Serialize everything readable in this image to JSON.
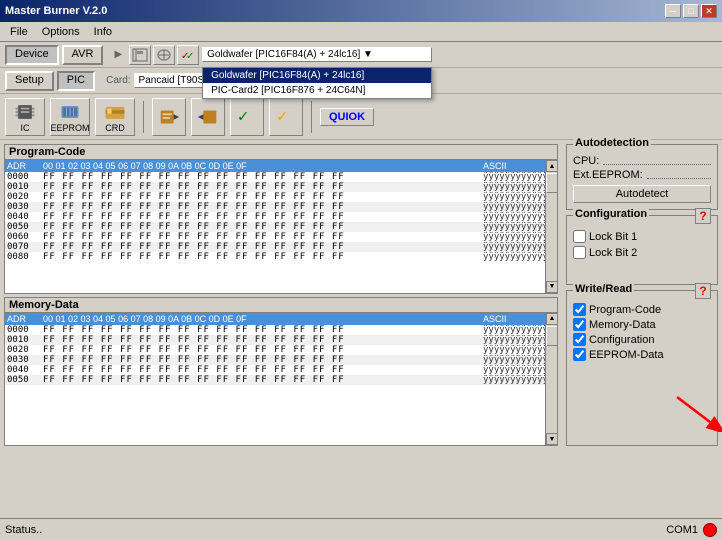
{
  "window": {
    "title": "Master Burner V.2.0",
    "min_btn": "─",
    "max_btn": "□",
    "close_btn": "✕"
  },
  "menu": {
    "items": [
      "File",
      "Options",
      "Info"
    ]
  },
  "toolbar": {
    "device_label": "Device",
    "avr_label": "AVR",
    "setup_label": "Setup",
    "pic_label": "PIC"
  },
  "dropdown_popup": {
    "items": [
      "Goldwafer [PIC16F84(A) + 24lc16]",
      "PIC-Card2 [PIC16F876 + 24C64N]"
    ],
    "selected": 0
  },
  "card_row": {
    "label": "Card:",
    "value": "Pancaid [T90S8515 + 24C64]"
  },
  "icon_buttons": [
    "IC",
    "EEPROM",
    "CRD",
    "QUIOK"
  ],
  "program_code": {
    "title": "Program-Code",
    "header": "ADR   00 01 02 03 04 05 06 07 08 09 0A 0B 0C 0D 0E 0F   ASCII",
    "rows": [
      {
        "addr": "0000",
        "bytes": "FF FF FF FF FF FF FF FF FF FF FF FF FF FF FF FF",
        "ascii": "ÿÿÿÿÿÿÿÿÿÿÿÿÿÿÿÿ"
      },
      {
        "addr": "0010",
        "bytes": "FF FF FF FF FF FF FF FF FF FF FF FF FF FF FF FF",
        "ascii": "ÿÿÿÿÿÿÿÿÿÿÿÿÿÿÿÿ"
      },
      {
        "addr": "0020",
        "bytes": "FF FF FF FF FF FF FF FF FF FF FF FF FF FF FF FF",
        "ascii": "ÿÿÿÿÿÿÿÿÿÿÿÿÿÿÿÿ"
      },
      {
        "addr": "0030",
        "bytes": "FF FF FF FF FF FF FF FF FF FF FF FF FF FF FF FF",
        "ascii": "ÿÿÿÿÿÿÿÿÿÿÿÿÿÿÿÿ"
      },
      {
        "addr": "0040",
        "bytes": "FF FF FF FF FF FF FF FF FF FF FF FF FF FF FF FF",
        "ascii": "ÿÿÿÿÿÿÿÿÿÿÿÿÿÿÿÿ"
      },
      {
        "addr": "0050",
        "bytes": "FF FF FF FF FF FF FF FF FF FF FF FF FF FF FF FF",
        "ascii": "ÿÿÿÿÿÿÿÿÿÿÿÿÿÿÿÿ"
      },
      {
        "addr": "0060",
        "bytes": "FF FF FF FF FF FF FF FF FF FF FF FF FF FF FF FF",
        "ascii": "ÿÿÿÿÿÿÿÿÿÿÿÿÿÿÿÿ"
      },
      {
        "addr": "0070",
        "bytes": "FF FF FF FF FF FF FF FF FF FF FF FF FF FF FF FF",
        "ascii": "ÿÿÿÿÿÿÿÿÿÿÿÿÿÿÿÿ"
      },
      {
        "addr": "0080",
        "bytes": "FF FF FF FF FF FF FF FF FF FF FF FF FF FF FF FF",
        "ascii": "ÿÿÿÿÿÿÿÿÿÿÿÿÿÿÿÿ"
      }
    ]
  },
  "memory_data": {
    "title": "Memory-Data",
    "header": "ADR   00 01 02 03 04 05 06 07 08 09 0A 0B 0C 0D 0E 0F   ASCII",
    "rows": [
      {
        "addr": "0000",
        "bytes": "FF FF FF FF FF FF FF FF FF FF FF FF FF FF FF FF",
        "ascii": "ÿÿÿÿÿÿÿÿÿÿÿÿÿÿÿÿ"
      },
      {
        "addr": "0010",
        "bytes": "FF FF FF FF FF FF FF FF FF FF FF FF FF FF FF FF",
        "ascii": "ÿÿÿÿÿÿÿÿÿÿÿÿÿÿÿÿ"
      },
      {
        "addr": "0020",
        "bytes": "FF FF FF FF FF FF FF FF FF FF FF FF FF FF FF FF",
        "ascii": "ÿÿÿÿÿÿÿÿÿÿÿÿÿÿÿÿ"
      },
      {
        "addr": "0030",
        "bytes": "FF FF FF FF FF FF FF FF FF FF FF FF FF FF FF FF",
        "ascii": "ÿÿÿÿÿÿÿÿÿÿÿÿÿÿÿÿ"
      },
      {
        "addr": "0040",
        "bytes": "FF FF FF FF FF FF FF FF FF FF FF FF FF FF FF FF",
        "ascii": "ÿÿÿÿÿÿÿÿÿÿÿÿÿÿÿÿ"
      },
      {
        "addr": "0050",
        "bytes": "FF FF FF FF FF FF FF FF FF FF FF FF FF FF FF FF",
        "ascii": "ÿÿÿÿÿÿÿÿÿÿÿÿÿÿÿÿ"
      }
    ]
  },
  "autodetection": {
    "title": "Autodetection",
    "cpu_label": "CPU:",
    "ext_eeprom_label": "Ext.EEPROM:",
    "autodetect_btn": "Autodetect"
  },
  "configuration": {
    "title": "Configuration",
    "lock_bit_1": "Lock Bit 1",
    "lock_bit_2": "Lock Bit 2"
  },
  "write_read": {
    "title": "Write/Read",
    "options": [
      "Program-Code",
      "Memory-Data",
      "Configuration",
      "EEPROM-Data"
    ]
  },
  "status_bar": {
    "status_text": "Status..",
    "com_label": "COM1"
  }
}
